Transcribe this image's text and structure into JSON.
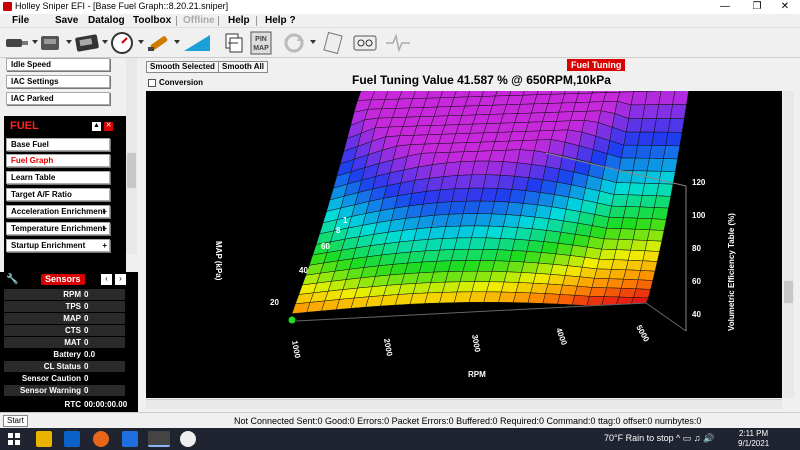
{
  "window": {
    "title": "Holley Sniper EFI - [Base Fuel Graph::8.20.21.sniper]"
  },
  "menu": {
    "file": "File",
    "save": "Save",
    "datalog": "Datalog",
    "toolbox": "Toolbox",
    "offline": "Offline",
    "help": "Help",
    "help_q": "Help ?"
  },
  "toolbar": {
    "pin_map_line1": "PIN",
    "pin_map_line2": "MAP"
  },
  "sidebar": {
    "upper_items": [
      "Idle Speed",
      "IAC Settings",
      "IAC Parked"
    ],
    "fuel_header": "FUEL",
    "fuel_items": [
      {
        "label": "Base Fuel",
        "plus": ""
      },
      {
        "label": "Fuel Graph",
        "plus": ""
      },
      {
        "label": "Learn Table",
        "plus": ""
      },
      {
        "label": "Target A/F Ratio",
        "plus": ""
      },
      {
        "label": "Acceleration Enrichment",
        "plus": "+"
      },
      {
        "label": "Temperature Enrichment",
        "plus": "+"
      },
      {
        "label": "Startup Enrichment",
        "plus": "+"
      }
    ]
  },
  "sensors": {
    "title": "Sensors",
    "rows": [
      {
        "name": "RPM",
        "value": "0"
      },
      {
        "name": "TPS",
        "value": "0"
      },
      {
        "name": "MAP",
        "value": "0"
      },
      {
        "name": "CTS",
        "value": "0"
      },
      {
        "name": "MAT",
        "value": "0"
      },
      {
        "name": "Battery",
        "value": "0.0"
      },
      {
        "name": "CL Status",
        "value": "0"
      },
      {
        "name": "Sensor Caution",
        "value": "0"
      },
      {
        "name": "Sensor Warning",
        "value": "0"
      },
      {
        "name": "RTC",
        "value": "00:00:00.00"
      }
    ]
  },
  "main": {
    "tag": "Fuel Tuning",
    "smooth_selected": "Smooth Selected",
    "smooth_all": "Smooth All",
    "conversion": "Conversion",
    "graph_title": "Fuel Tuning Value 41.587 % @ 650RPM,10kPa",
    "axes": {
      "map_label": "MAP (kPa)",
      "map_ticks": [
        "20",
        "40",
        "60",
        "8",
        "1"
      ],
      "rpm_label": "RPM",
      "rpm_ticks": [
        "1000",
        "2000",
        "3000",
        "4000",
        "5000"
      ],
      "ve_label": "Volumetric Efficiency Table (%)",
      "ve_ticks": [
        "120",
        "100",
        "80",
        "60",
        "40"
      ]
    }
  },
  "statusbar": {
    "start": "Start",
    "connection": "Not Connected   Sent:0 Good:0 Errors:0 Packet Errors:0 Buffered:0 Required:0       Command:0 ttag:0 offset:0 numbytes:0"
  },
  "taskbar": {
    "weather": "70°F  Rain to stop",
    "time": "2:11 PM",
    "date": "9/1/2021"
  }
}
